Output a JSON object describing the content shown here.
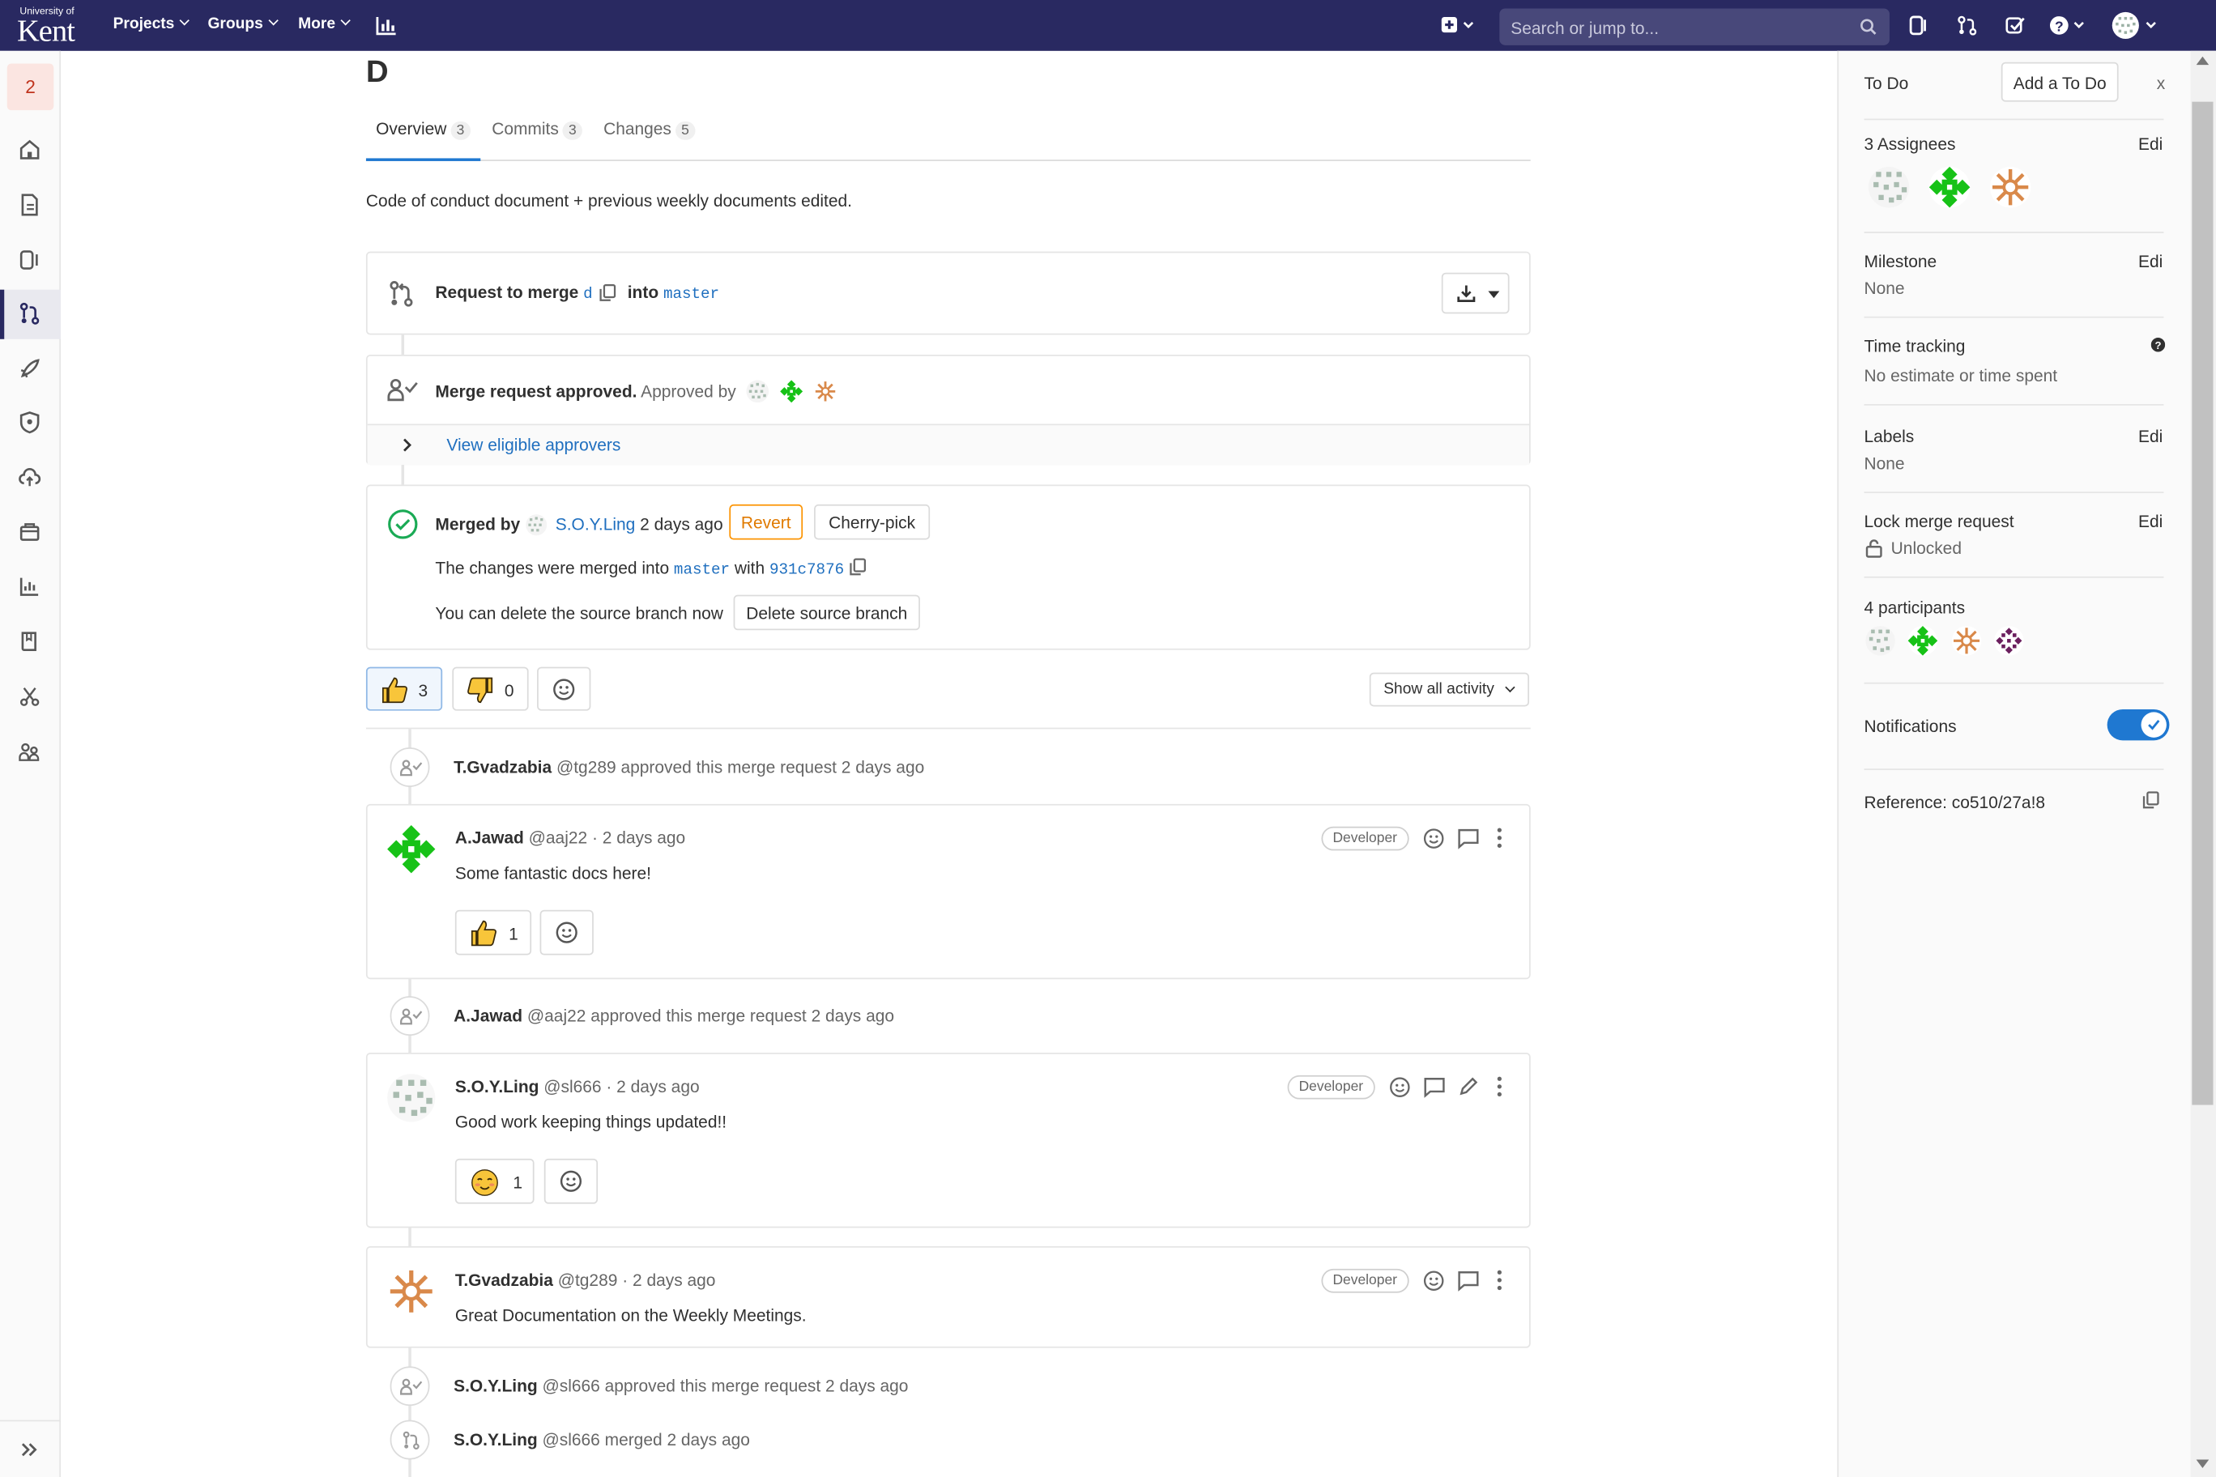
{
  "nav": {
    "logo_top": "University of",
    "logo_main": "Kent",
    "projects": "Projects",
    "groups": "Groups",
    "more": "More",
    "search_placeholder": "Search or jump to..."
  },
  "sidebar": {
    "badge": "2",
    "icons": [
      "home-icon",
      "document-icon",
      "issues-icon",
      "merge-request-icon",
      "rocket-icon",
      "shield-icon",
      "cloud-icon",
      "package-icon",
      "analytics-icon",
      "wiki-icon",
      "snippets-icon",
      "members-icon"
    ],
    "active_index": 3
  },
  "mr": {
    "title": "D",
    "description": "Code of conduct document + previous weekly documents edited.",
    "tabs": [
      {
        "label": "Overview",
        "count": "3"
      },
      {
        "label": "Commits",
        "count": "3"
      },
      {
        "label": "Changes",
        "count": "5"
      }
    ],
    "request_prefix": "Request to merge",
    "source_branch": "d",
    "into": "into",
    "target_branch": "master",
    "approved_text": "Merge request approved.",
    "approved_by": "Approved by",
    "view_approvers": "View eligible approvers",
    "merged_by": "Merged by",
    "merged_user": "S.O.Y.Ling",
    "merged_time": "2 days ago",
    "revert": "Revert",
    "cherry_pick": "Cherry-pick",
    "merged_into_text": "The changes were merged into",
    "merged_target": "master",
    "merged_with": "with",
    "commit_sha": "931c7876",
    "delete_text": "You can delete the source branch now",
    "delete_button": "Delete source branch",
    "thumbs_up_count": "3",
    "thumbs_down_count": "0",
    "activity_filter": "Show all activity"
  },
  "timeline": {
    "event1": {
      "name": "T.Gvadzabia",
      "rest": "@tg289 approved this merge request 2 days ago"
    },
    "comment1": {
      "name": "A.Jawad",
      "meta": "@aaj22 · 2 days ago",
      "role": "Developer",
      "body": "Some fantastic docs here!",
      "reaction_count": "1"
    },
    "event2": {
      "name": "A.Jawad",
      "rest": "@aaj22 approved this merge request 2 days ago"
    },
    "comment2": {
      "name": "S.O.Y.Ling",
      "meta": "@sl666 · 2 days ago",
      "role": "Developer",
      "body": "Good work keeping things updated!!",
      "reaction_count": "1"
    },
    "comment3": {
      "name": "T.Gvadzabia",
      "meta": "@tg289 · 2 days ago",
      "role": "Developer",
      "body": "Great Documentation on the Weekly Meetings."
    },
    "event3": {
      "name": "S.O.Y.Ling",
      "rest": "@sl666 approved this merge request 2 days ago"
    },
    "event4": {
      "name": "S.O.Y.Ling",
      "rest": "@sl666 merged 2 days ago"
    }
  },
  "right_sidebar": {
    "todo_label": "To Do",
    "add_todo": "Add a To Do",
    "close": "x",
    "assignees": "3 Assignees",
    "edit": "Edi",
    "milestone": "Milestone",
    "milestone_value": "None",
    "time_tracking": "Time tracking",
    "time_value": "No estimate or time spent",
    "labels": "Labels",
    "labels_value": "None",
    "lock": "Lock merge request",
    "lock_value": "Unlocked",
    "participants": "4 participants",
    "notifications": "Notifications",
    "notifications_on": true,
    "reference": "Reference: co510/27a!8"
  },
  "colors": {
    "nav_bg": "#292961",
    "link": "#1f6fbf",
    "success": "#1aaa55",
    "revert": "#fc9403",
    "toggle": "#1f78d1"
  }
}
